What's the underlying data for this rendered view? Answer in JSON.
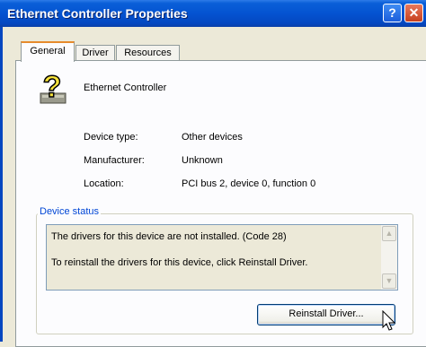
{
  "window": {
    "title": "Ethernet Controller Properties",
    "help_label": "?",
    "close_label": "✕"
  },
  "tabs": [
    {
      "label": "General",
      "active": true
    },
    {
      "label": "Driver",
      "active": false
    },
    {
      "label": "Resources",
      "active": false
    }
  ],
  "device": {
    "name": "Ethernet Controller",
    "icon": "unknown-device-question-icon"
  },
  "properties": [
    {
      "label": "Device type:",
      "value": "Other devices"
    },
    {
      "label": "Manufacturer:",
      "value": "Unknown"
    },
    {
      "label": "Location:",
      "value": "PCI bus 2, device 0, function 0"
    }
  ],
  "device_status": {
    "title": "Device status",
    "lines": [
      "The drivers for this device are not installed. (Code 28)",
      "To reinstall the drivers for this device, click Reinstall Driver."
    ]
  },
  "buttons": {
    "reinstall_label": "Reinstall Driver..."
  },
  "colors": {
    "title_bar": "#0453d1",
    "group_title": "#0046d5",
    "active_tab_accent": "#e68b2c"
  }
}
